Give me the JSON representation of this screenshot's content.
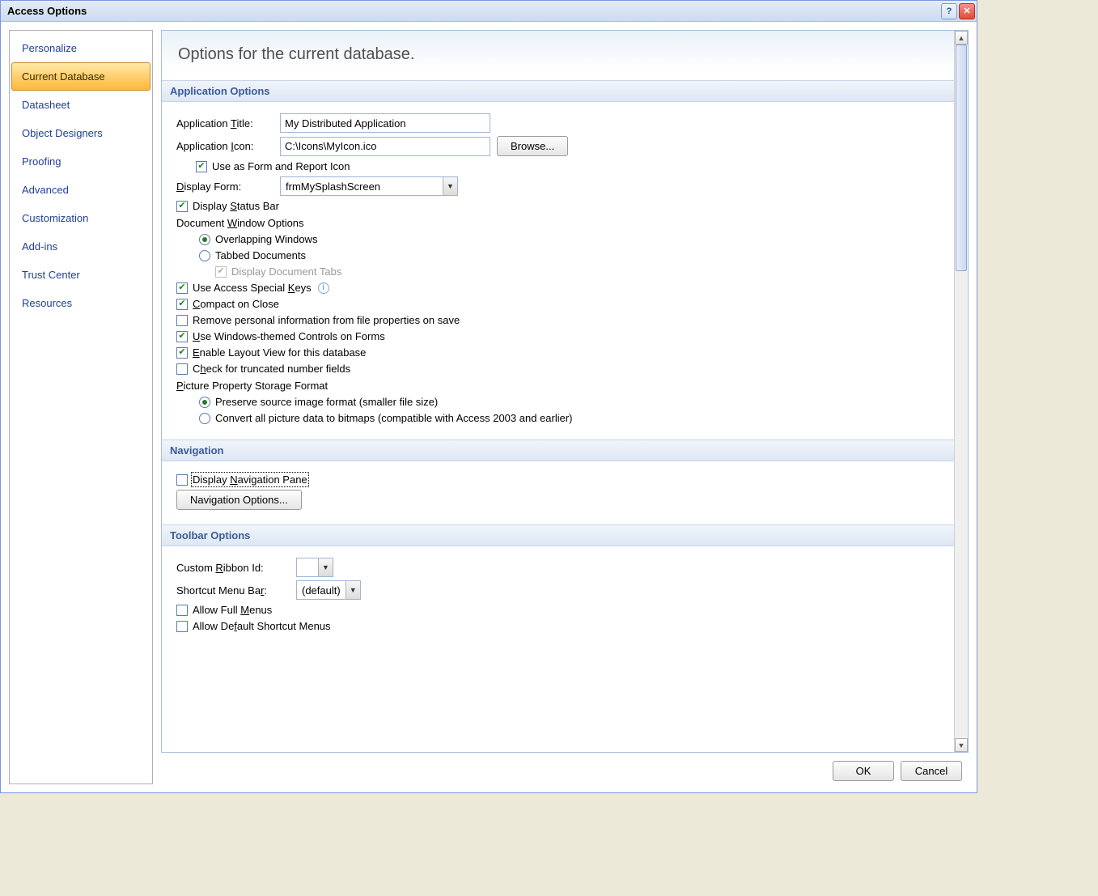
{
  "titlebar": {
    "title": "Access Options"
  },
  "sidebar": {
    "items": [
      "Personalize",
      "Current Database",
      "Datasheet",
      "Object Designers",
      "Proofing",
      "Advanced",
      "Customization",
      "Add-ins",
      "Trust Center",
      "Resources"
    ],
    "selected_index": 1
  },
  "page_title": "Options for the current database.",
  "sections": {
    "app_options": {
      "header": "Application Options",
      "app_title_label": "Application Title:",
      "app_title_value": "My Distributed Application",
      "app_icon_label": "Application Icon:",
      "app_icon_value": "C:\\Icons\\MyIcon.ico",
      "browse_btn": "Browse...",
      "use_as_form_icon": "Use as Form and Report Icon",
      "display_form_label": "Display Form:",
      "display_form_value": "frmMySplashScreen",
      "display_status_bar": "Display Status Bar",
      "doc_window_header": "Document Window Options",
      "overlapping": "Overlapping Windows",
      "tabbed": "Tabbed Documents",
      "display_doc_tabs": "Display Document Tabs",
      "special_keys": "Use Access Special Keys",
      "compact_close": "Compact on Close",
      "remove_personal": "Remove personal information from file properties on save",
      "win_themed": "Use Windows-themed Controls on Forms",
      "layout_view": "Enable Layout View for this database",
      "check_truncated": "Check for truncated number fields",
      "pic_header": "Picture Property Storage Format",
      "pic_preserve": "Preserve source image format (smaller file size)",
      "pic_convert": "Convert all picture data to bitmaps (compatible with Access 2003 and earlier)"
    },
    "navigation": {
      "header": "Navigation",
      "display_nav_pane": "Display Navigation Pane",
      "nav_options_btn": "Navigation Options..."
    },
    "toolbar": {
      "header": "Toolbar Options",
      "ribbon_label": "Custom Ribbon Id:",
      "ribbon_value": "",
      "shortcut_label": "Shortcut Menu Bar:",
      "shortcut_value": "(default)",
      "allow_full_menus": "Allow Full Menus",
      "allow_shortcut_menus": "Allow Default Shortcut Menus"
    }
  },
  "footer": {
    "ok": "OK",
    "cancel": "Cancel"
  }
}
